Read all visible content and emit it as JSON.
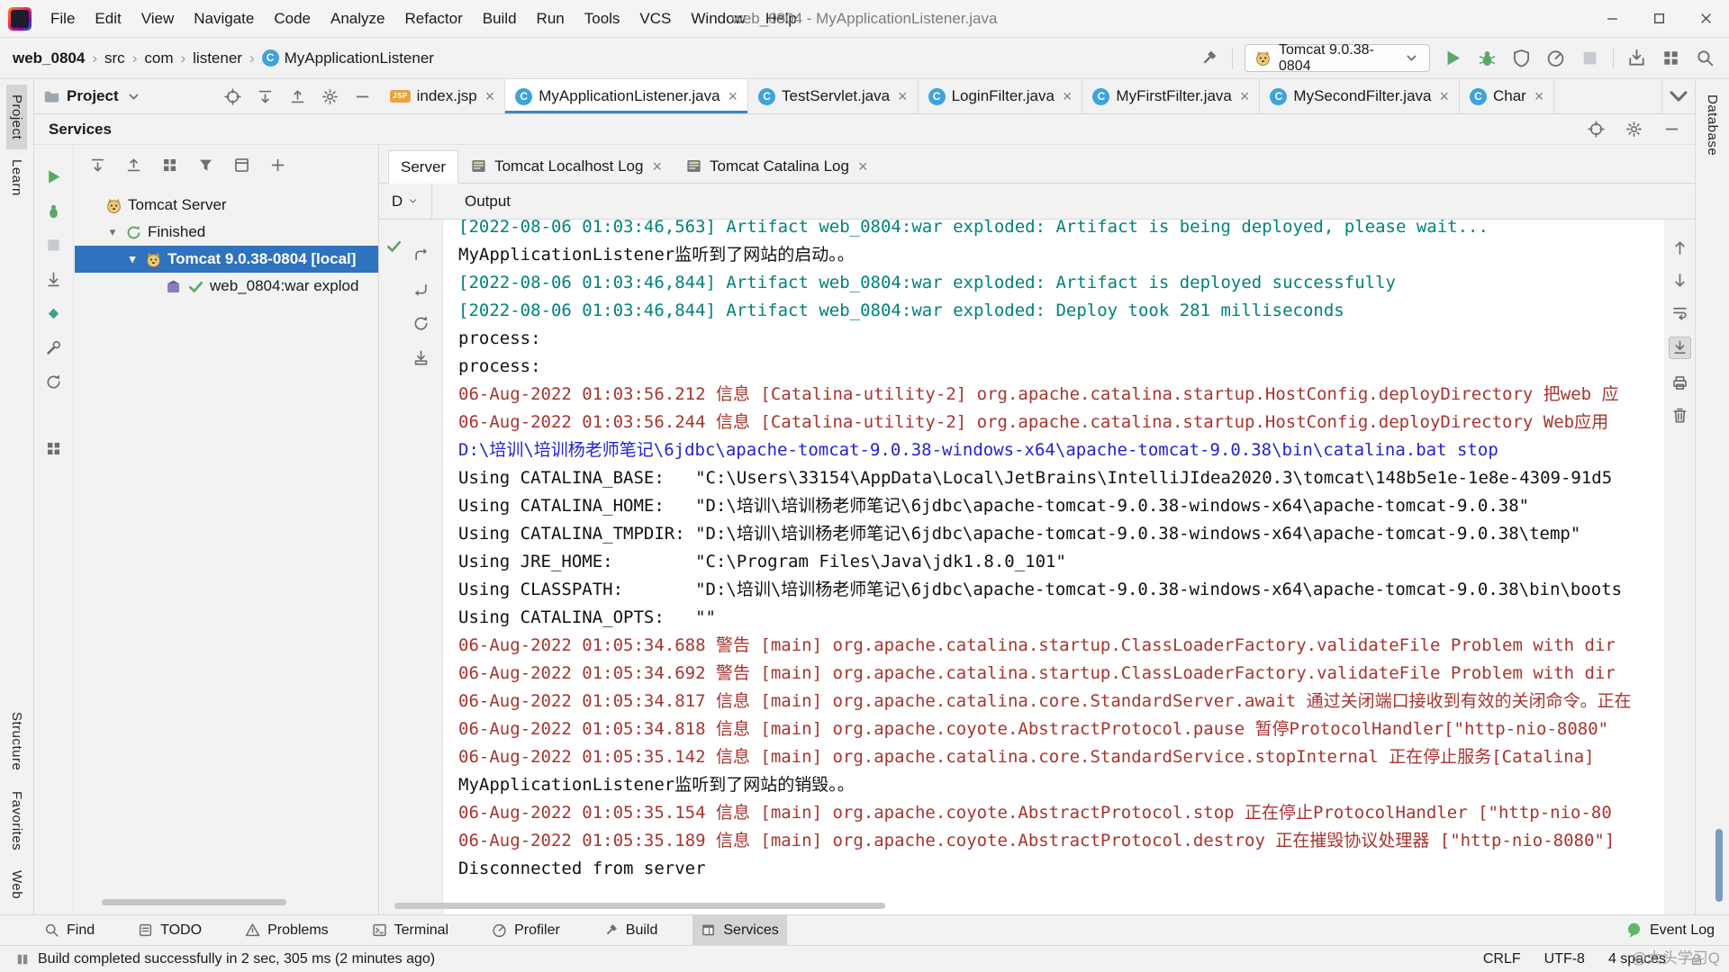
{
  "palette": {
    "selection_blue": "#2f72bd",
    "tab_underline": "#4083c9",
    "run_green": "#59a869",
    "console_teal": "#00827a",
    "console_red": "#a8342e",
    "console_blue": "#2323d1",
    "console_black": "#111111"
  },
  "icons": {
    "chevron_down": "▾",
    "close": "×",
    "breadcrumb_separator": "›"
  },
  "titlebar": {
    "menu_items": [
      "File",
      "Edit",
      "View",
      "Navigate",
      "Code",
      "Analyze",
      "Refactor",
      "Build",
      "Run",
      "Tools",
      "VCS",
      "Window",
      "Help"
    ],
    "title": "web_0804 - MyApplicationListener.java"
  },
  "toolbar": {
    "breadcrumbs": [
      "web_0804",
      "src",
      "com",
      "listener"
    ],
    "breadcrumb_class": "MyApplicationListener",
    "run_config": "Tomcat 9.0.38-0804"
  },
  "project_panel": {
    "title": "Project"
  },
  "editor_tabs": [
    {
      "label": "index.jsp",
      "icon": "jsp",
      "active": false
    },
    {
      "label": "MyApplicationListener.java",
      "icon": "class",
      "active": true
    },
    {
      "label": "TestServlet.java",
      "icon": "class",
      "active": false
    },
    {
      "label": "LoginFilter.java",
      "icon": "class",
      "active": false
    },
    {
      "label": "MyFirstFilter.java",
      "icon": "class",
      "active": false
    },
    {
      "label": "MySecondFilter.java",
      "icon": "class",
      "active": false
    },
    {
      "label": "Char",
      "icon": "class",
      "active": false
    }
  ],
  "left_stripe_top": [
    {
      "label": "Project",
      "active": true
    },
    {
      "label": "Learn",
      "active": false
    }
  ],
  "left_stripe_bottom": [
    {
      "label": "Structure",
      "active": false
    },
    {
      "label": "Favorites",
      "active": false
    },
    {
      "label": "Web",
      "active": false
    }
  ],
  "right_stripe": [
    {
      "label": "Database",
      "active": false
    }
  ],
  "services": {
    "title": "Services",
    "deploy_tab": "D",
    "output_label": "Output",
    "tabs": [
      {
        "label": "Server",
        "active": true,
        "icon": false,
        "closable": false
      },
      {
        "label": "Tomcat Localhost Log",
        "active": false,
        "icon": true,
        "closable": true
      },
      {
        "label": "Tomcat Catalina Log",
        "active": false,
        "icon": true,
        "closable": true
      }
    ],
    "tree": [
      {
        "label": "Tomcat Server",
        "indent": 0,
        "icon": "tomcat",
        "chevron": false,
        "selected": false,
        "check": false
      },
      {
        "label": "Finished",
        "indent": 1,
        "icon": "finished",
        "chevron": true,
        "selected": false,
        "check": false
      },
      {
        "label": "Tomcat 9.0.38-0804 [local]",
        "indent": 2,
        "icon": "tomcat",
        "chevron": true,
        "selected": true,
        "check": false
      },
      {
        "label": "web_0804:war explod",
        "indent": 3,
        "icon": "artifact",
        "chevron": false,
        "selected": false,
        "check": true
      }
    ],
    "console": [
      {
        "color": "teal",
        "text": "[2022-08-06 01:03:46,563] Artifact web_0804:war exploded: Artifact is being deployed, please wait..."
      },
      {
        "color": "black",
        "text": "MyApplicationListener监听到了网站的启动。。"
      },
      {
        "color": "teal",
        "text": "[2022-08-06 01:03:46,844] Artifact web_0804:war exploded: Artifact is deployed successfully"
      },
      {
        "color": "teal",
        "text": "[2022-08-06 01:03:46,844] Artifact web_0804:war exploded: Deploy took 281 milliseconds"
      },
      {
        "color": "black",
        "text": "process:"
      },
      {
        "color": "black",
        "text": "process:"
      },
      {
        "color": "red",
        "text": "06-Aug-2022 01:03:56.212 信息 [Catalina-utility-2] org.apache.catalina.startup.HostConfig.deployDirectory 把web 应"
      },
      {
        "color": "red",
        "text": "06-Aug-2022 01:03:56.244 信息 [Catalina-utility-2] org.apache.catalina.startup.HostConfig.deployDirectory Web应用"
      },
      {
        "color": "blue",
        "text": "D:\\培训\\培训杨老师笔记\\6jdbc\\apache-tomcat-9.0.38-windows-x64\\apache-tomcat-9.0.38\\bin\\catalina.bat stop"
      },
      {
        "color": "black",
        "text": "Using CATALINA_BASE:   \"C:\\Users\\33154\\AppData\\Local\\JetBrains\\IntelliJIdea2020.3\\tomcat\\148b5e1e-1e8e-4309-91d5"
      },
      {
        "color": "black",
        "text": "Using CATALINA_HOME:   \"D:\\培训\\培训杨老师笔记\\6jdbc\\apache-tomcat-9.0.38-windows-x64\\apache-tomcat-9.0.38\""
      },
      {
        "color": "black",
        "text": "Using CATALINA_TMPDIR: \"D:\\培训\\培训杨老师笔记\\6jdbc\\apache-tomcat-9.0.38-windows-x64\\apache-tomcat-9.0.38\\temp\""
      },
      {
        "color": "black",
        "text": "Using JRE_HOME:        \"C:\\Program Files\\Java\\jdk1.8.0_101\""
      },
      {
        "color": "black",
        "text": "Using CLASSPATH:       \"D:\\培训\\培训杨老师笔记\\6jdbc\\apache-tomcat-9.0.38-windows-x64\\apache-tomcat-9.0.38\\bin\\boots"
      },
      {
        "color": "black",
        "text": "Using CATALINA_OPTS:   \"\""
      },
      {
        "color": "red",
        "text": "06-Aug-2022 01:05:34.688 警告 [main] org.apache.catalina.startup.ClassLoaderFactory.validateFile Problem with dir"
      },
      {
        "color": "red",
        "text": "06-Aug-2022 01:05:34.692 警告 [main] org.apache.catalina.startup.ClassLoaderFactory.validateFile Problem with dir"
      },
      {
        "color": "red",
        "text": "06-Aug-2022 01:05:34.817 信息 [main] org.apache.catalina.core.StandardServer.await 通过关闭端口接收到有效的关闭命令。正在"
      },
      {
        "color": "red",
        "text": "06-Aug-2022 01:05:34.818 信息 [main] org.apache.coyote.AbstractProtocol.pause 暂停ProtocolHandler[\"http-nio-8080\""
      },
      {
        "color": "red",
        "text": "06-Aug-2022 01:05:35.142 信息 [main] org.apache.catalina.core.StandardService.stopInternal 正在停止服务[Catalina]"
      },
      {
        "color": "black",
        "text": "MyApplicationListener监听到了网站的销毁。。"
      },
      {
        "color": "red",
        "text": "06-Aug-2022 01:05:35.154 信息 [main] org.apache.coyote.AbstractProtocol.stop 正在停止ProtocolHandler [\"http-nio-80"
      },
      {
        "color": "red",
        "text": "06-Aug-2022 01:05:35.189 信息 [main] org.apache.coyote.AbstractProtocol.destroy 正在摧毁协议处理器 [\"http-nio-8080\"]"
      },
      {
        "color": "black",
        "text": "Disconnected from server"
      }
    ]
  },
  "bottom_bar": {
    "items": [
      {
        "label": "Find",
        "icon": "find",
        "active": false
      },
      {
        "label": "TODO",
        "icon": "todo",
        "active": false
      },
      {
        "label": "Problems",
        "icon": "problems",
        "active": false
      },
      {
        "label": "Terminal",
        "icon": "terminal",
        "active": false
      },
      {
        "label": "Profiler",
        "icon": "profiler",
        "active": false
      },
      {
        "label": "Build",
        "icon": "build",
        "active": false
      },
      {
        "label": "Services",
        "icon": "services",
        "active": true
      }
    ],
    "event_log": "Event Log"
  },
  "status_bar": {
    "message": "Build completed successfully in 2 sec, 305 ms (2 minutes ago)",
    "line_ending": "CRLF",
    "encoding": "UTF-8",
    "indent": "4 spaces",
    "watermark": "@大头学习Q"
  }
}
